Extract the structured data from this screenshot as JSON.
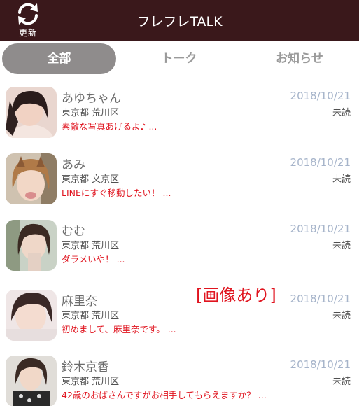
{
  "header": {
    "refresh_label": "更新",
    "title": "フレフレTALK",
    "background_color": "#3a181b"
  },
  "tabs": [
    {
      "label": "全部",
      "active": true
    },
    {
      "label": "トーク",
      "active": false
    },
    {
      "label": "お知らせ",
      "active": false
    }
  ],
  "messages": [
    {
      "name": "あゆちゃん",
      "location": "東京都 荒川区",
      "preview": "素敵な写真あげるよ♪ ...",
      "date": "2018/10/21",
      "status": "未読",
      "badge": ""
    },
    {
      "name": "あみ",
      "location": "東京都 文京区",
      "preview": "LINEにすぐ移動したい！ ...",
      "date": "2018/10/21",
      "status": "未読",
      "badge": ""
    },
    {
      "name": "むむ",
      "location": "東京都 荒川区",
      "preview": "ダラメいや！ ...",
      "date": "2018/10/21",
      "status": "未読",
      "badge": ""
    },
    {
      "name": "麻里奈",
      "location": "東京都 荒川区",
      "preview": "初めまして、麻里奈です。 ...",
      "date": "2018/10/21",
      "status": "未読",
      "badge": "[画像あり]"
    },
    {
      "name": "鈴木京香",
      "location": "東京都 荒川区",
      "preview": "42歳のおばさんですがお相手してもらえますか？ ...",
      "date": "2018/10/21",
      "status": "未読",
      "badge": ""
    }
  ],
  "colors": {
    "accent_red": "#e0141f",
    "date_blue": "#a6b4ca",
    "tab_active_bg": "#8f8c8c"
  }
}
